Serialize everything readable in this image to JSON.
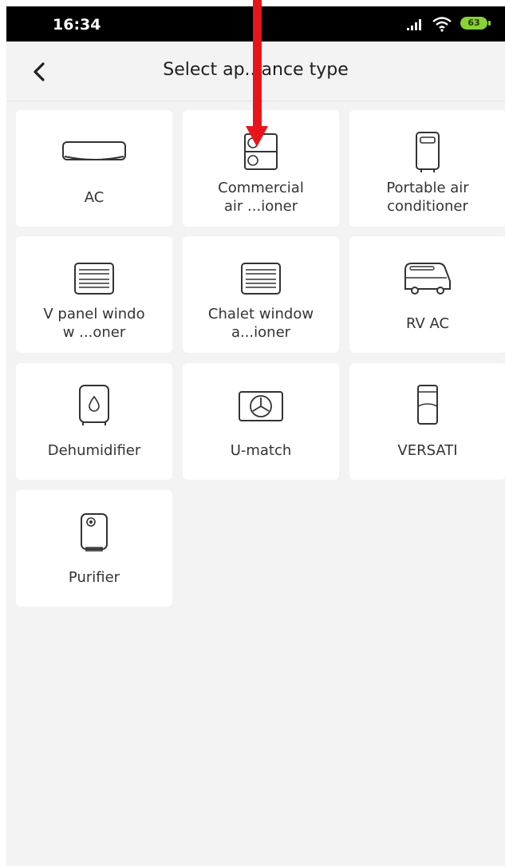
{
  "status_bar": {
    "time": "16:34",
    "battery": "63"
  },
  "header": {
    "title": "Select ap...ance type"
  },
  "appliances": [
    {
      "label": "AC",
      "icon": "ac-unit-icon"
    },
    {
      "label": "Commercial\nair ...ioner",
      "icon": "commercial-ac-icon"
    },
    {
      "label": "Portable air\nconditioner",
      "icon": "portable-ac-icon"
    },
    {
      "label": "V panel windo\nw ...oner",
      "icon": "window-ac-icon"
    },
    {
      "label": "Chalet window\na...ioner",
      "icon": "window-ac-icon"
    },
    {
      "label": "RV AC",
      "icon": "rv-icon"
    },
    {
      "label": "Dehumidifier",
      "icon": "dehumidifier-icon"
    },
    {
      "label": "U-match",
      "icon": "fan-unit-icon"
    },
    {
      "label": "VERSATI",
      "icon": "versati-icon"
    },
    {
      "label": "Purifier",
      "icon": "purifier-icon"
    }
  ],
  "annotation": {
    "color": "#e8141b"
  }
}
